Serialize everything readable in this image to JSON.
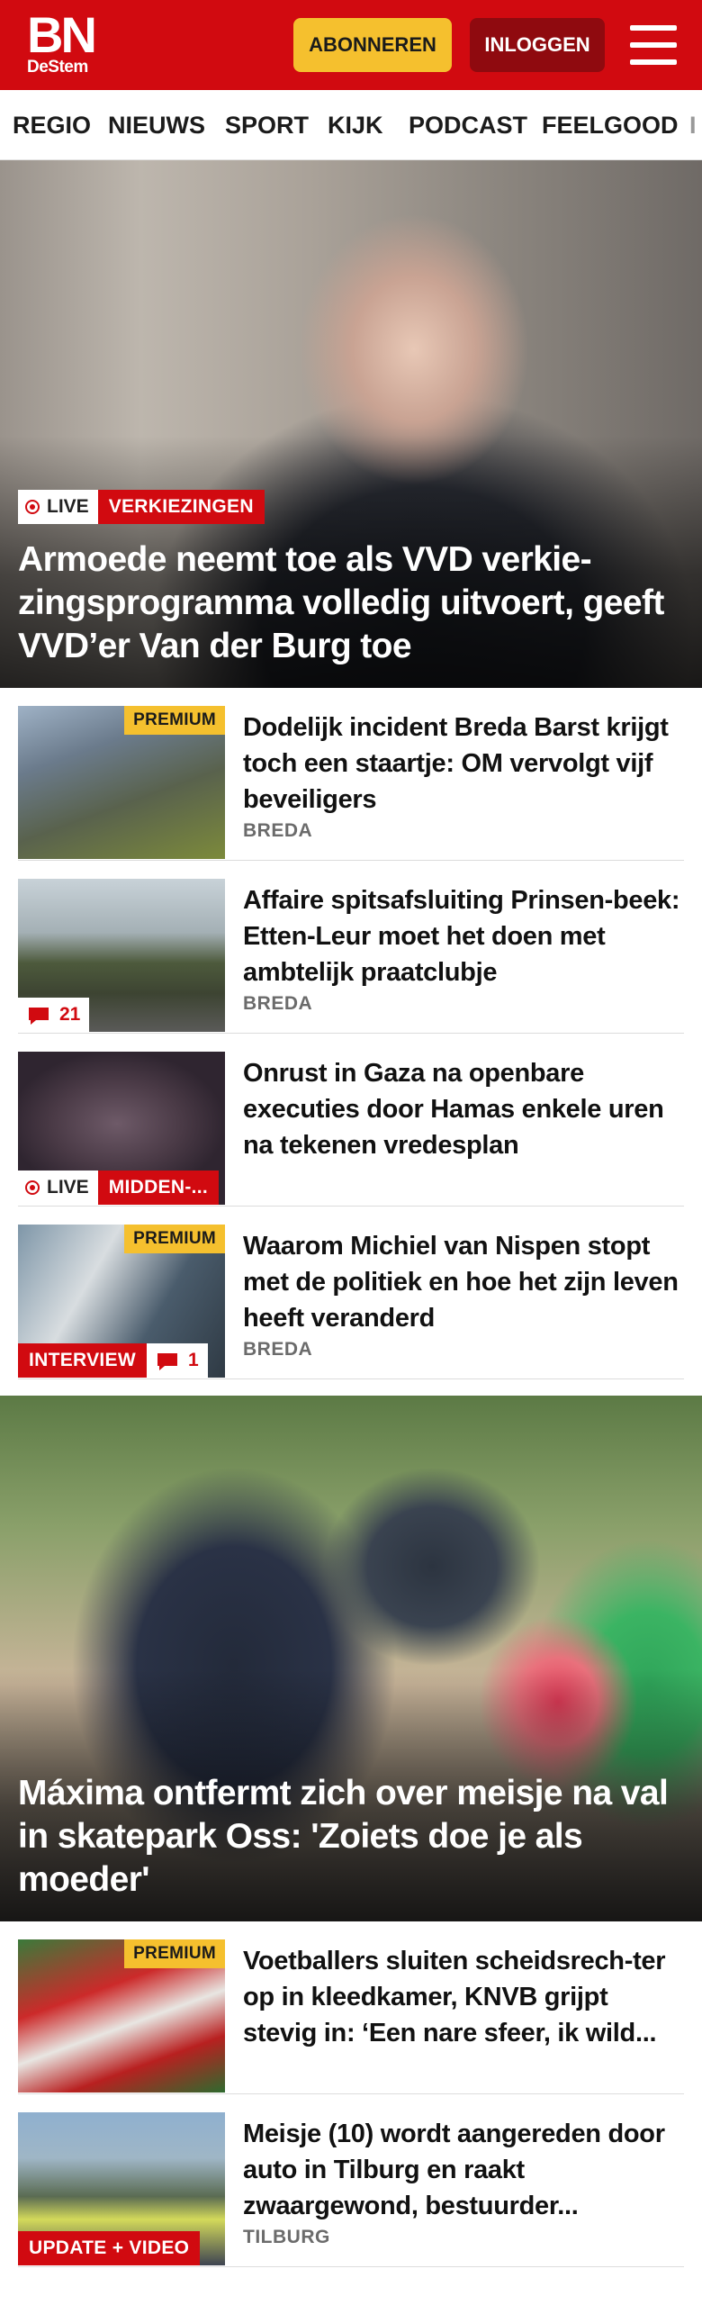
{
  "header": {
    "logo_main": "BN",
    "logo_sub": "DeStem",
    "subscribe_label": "ABONNEREN",
    "login_label": "INLOGGEN",
    "brand_color": "#d10a10",
    "accent_color": "#f5c02e"
  },
  "nav": {
    "items": [
      "REGIO",
      "NIEUWS",
      "SPORT",
      "KIJK",
      "PODCAST",
      "FEELGOOD",
      "I"
    ]
  },
  "hero1": {
    "live_label": "LIVE",
    "tag": "VERKIEZINGEN",
    "title": "Armoede neemt toe als VVD verkie-zingsprogramma volledig uitvoert, geeft VVD’er Van der Burg toe"
  },
  "articles": [
    {
      "title": "Dodelijk incident Breda Barst krijgt toch een staartje: OM vervolgt vijf beveiligers",
      "location": "BREDA",
      "premium": "PREMIUM"
    },
    {
      "title": "Affaire spitsafsluiting Prinsen-beek: Etten-Leur moet het doen met ambtelijk praatclubje",
      "location": "BREDA",
      "comments": "21"
    },
    {
      "title": "Onrust in Gaza na openbare executies door Hamas enkele uren na tekenen vredesplan",
      "live_label": "LIVE",
      "tag": "MIDDEN-..."
    },
    {
      "title": "Waarom Michiel van Nispen stopt met de politiek en hoe het zijn leven heeft veranderd",
      "location": "BREDA",
      "premium": "PREMIUM",
      "tag": "INTERVIEW",
      "comments": "1"
    }
  ],
  "hero2": {
    "title": "Máxima ontfermt zich over meisje na val in skatepark Oss: 'Zoiets doe je als moeder'"
  },
  "articles2": [
    {
      "title": "Voetballers sluiten scheidsrech-ter op in kleedkamer, KNVB grijpt stevig in: ‘Een nare sfeer, ik wild...",
      "premium": "PREMIUM"
    },
    {
      "title": "Meisje (10) wordt aangereden door auto in Tilburg en raakt zwaargewond, bestuurder...",
      "location": "TILBURG",
      "tag": "UPDATE + VIDEO"
    }
  ]
}
